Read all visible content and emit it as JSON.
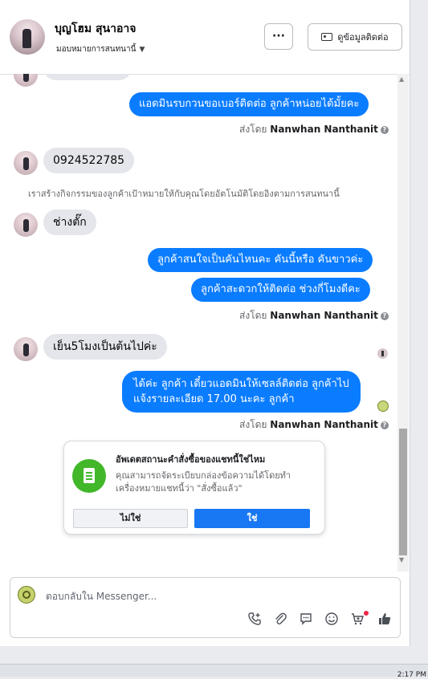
{
  "header": {
    "contact_name": "บุญโฮม สุนาอาจ",
    "assign_label": "มอบหมายการสนทนานี้",
    "more_label": "···",
    "contact_info_label": "ดูข้อมูลติดต่อ"
  },
  "messages": {
    "out_1": "แอดมินรบกวนขอเบอร์ติดต่อ ลูกค้าหน่อยได้มั้ยคะ",
    "sent_by_prefix": "ส่งโดย",
    "sender_name": "Nanwhan Nanthanit",
    "in_1": "0924522785",
    "system_note": "เราสร้างกิจกรรมของลูกค้าเป้าหมายให้กับคุณโดยอัตโนมัติโดยอิงตามการสนทนานี้",
    "in_2": "ช่างตั๊ก",
    "out_2": "ลูกค้าสนใจเป็นคันไหนคะ คันนี้หรือ คันขาวค่ะ",
    "out_3": "ลูกค้าสะดวกให้ติดต่อ ช่วงกี่โมงดีคะ",
    "in_3": "เย็น5โมงเป็นต้นไปค่ะ",
    "out_4_line1": "ได้ค่ะ ลูกค้า เดี๋ยวแอดมินให้เซลล์ติดต่อ ลูกค้าไป",
    "out_4_line2": "แจ้งรายละเอียด 17.00 นะคะ ลูกค้า"
  },
  "order_card": {
    "title": "อัพเดตสถานะคำสั่งซื้อของแชทนี้ใช่ไหม",
    "description": "คุณสามารถจัดระเบียบกล่องข้อความได้โดยทำเครื่องหมายแชทนี้ว่า \"สั่งซื้อแล้ว\"",
    "no_label": "ไม่ใช่",
    "yes_label": "ใช่"
  },
  "composer": {
    "placeholder": "ตอบกลับใน Messenger..."
  },
  "taskbar": {
    "clock": "2:17 PM"
  },
  "colors": {
    "outgoing_bubble": "#0a7cff",
    "incoming_bubble": "#e4e6eb",
    "primary_button": "#1877f2",
    "order_icon": "#42b72a"
  },
  "icons": [
    "chevron-down-icon",
    "contact-card-icon",
    "question-icon",
    "call-add-icon",
    "attachment-icon",
    "saved-reply-icon",
    "emoji-icon",
    "cart-icon",
    "thumbs-up-icon"
  ]
}
